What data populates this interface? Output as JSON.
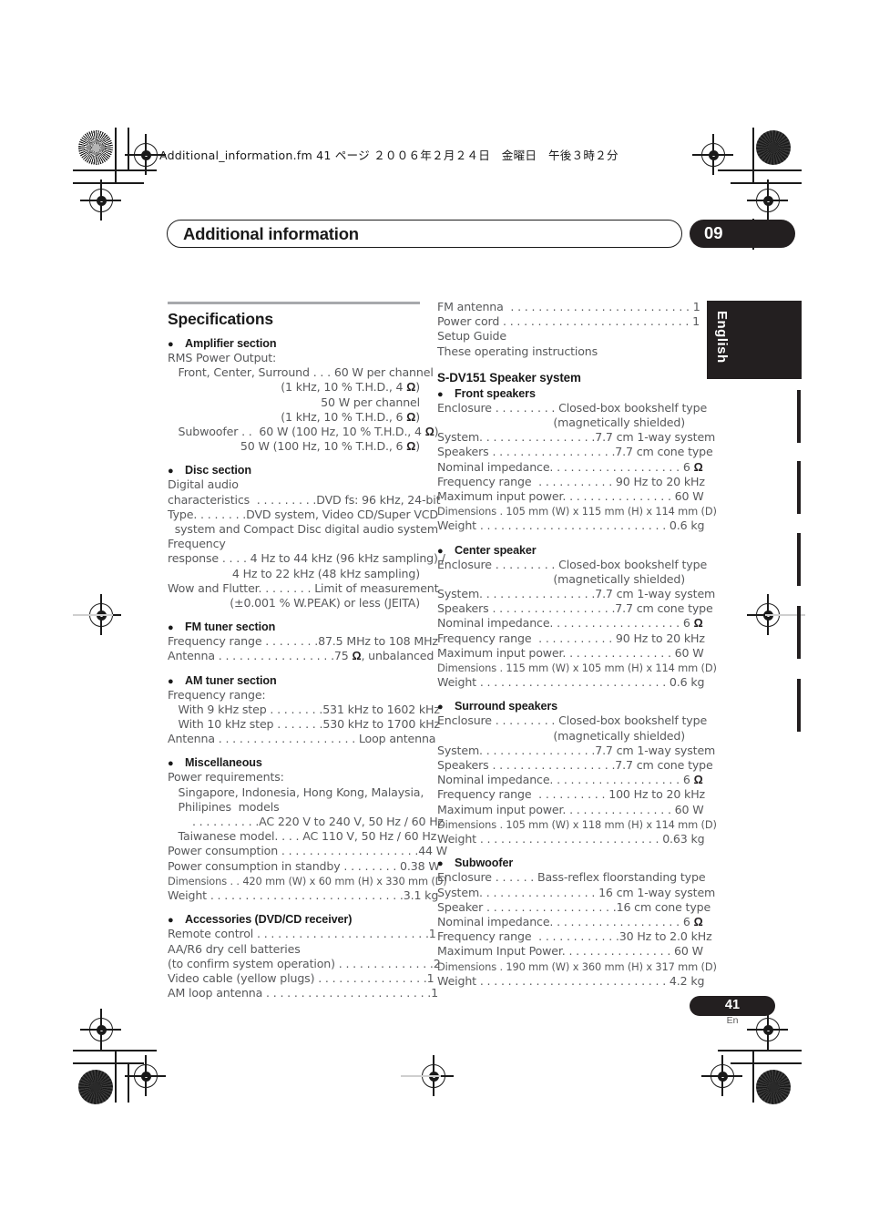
{
  "print_slug": "Additional_information.fm  41 ページ  ２００６年２月２４日　金曜日　午後３時２分",
  "chapter": {
    "title": "Additional information",
    "number": "09"
  },
  "side_tab_label": "English",
  "footer": {
    "page_number": "41",
    "language": "En"
  },
  "colors": {
    "ink": "#231f20",
    "body_text": "#58595b",
    "rule": "#a7a9ac"
  },
  "left_column": {
    "section_title": "Specifications",
    "groups": [
      {
        "heading": "Amplifier section",
        "lines": [
          {
            "text": "RMS Power Output:",
            "align": "left"
          },
          {
            "text": "   Front, Center, Surround . . . 60 W per channel",
            "align": "left"
          },
          {
            "text": "(1 kHz, 10 % T.H.D., 4 Ω)",
            "align": "right"
          },
          {
            "text": "50 W per channel",
            "align": "right"
          },
          {
            "text": "(1 kHz, 10 % T.H.D., 6 Ω)",
            "align": "right"
          },
          {
            "text": "   Subwoofer . .  60 W (100 Hz, 10 % T.H.D., 4 Ω)",
            "align": "left"
          },
          {
            "text": "50 W (100 Hz, 10 % T.H.D., 6 Ω)",
            "align": "right"
          }
        ]
      },
      {
        "heading": "Disc section",
        "lines": [
          {
            "text": "Digital audio",
            "align": "left"
          },
          {
            "text": "characteristics  . . . . . . . . .DVD fs: 96 kHz, 24-bit",
            "align": "left"
          },
          {
            "text": "Type. . . . . . . .DVD system, Video CD/Super VCD",
            "align": "left"
          },
          {
            "text": "  system and Compact Disc digital audio system",
            "align": "left"
          },
          {
            "text": "Frequency",
            "align": "left"
          },
          {
            "text": "response . . . . 4 Hz to 44 kHz (96 kHz sampling) /",
            "align": "left"
          },
          {
            "text": "4 Hz to 22 kHz (48 kHz sampling)",
            "align": "right"
          },
          {
            "text": "Wow and Flutter. . . . . . . . Limit of measurement",
            "align": "left"
          },
          {
            "text": "(±0.001 % W.PEAK) or less (JEITA)",
            "align": "right"
          }
        ]
      },
      {
        "heading": "FM tuner section",
        "lines": [
          {
            "text": "Frequency range . . . . . . . .87.5 MHz to 108 MHz",
            "align": "left"
          },
          {
            "text": "Antenna . . . . . . . . . . . . . . . . .75 Ω, unbalanced",
            "align": "left"
          }
        ]
      },
      {
        "heading": "AM tuner section",
        "lines": [
          {
            "text": "Frequency range:",
            "align": "left"
          },
          {
            "text": "   With 9 kHz step . . . . . . . .531 kHz to 1602 kHz",
            "align": "left"
          },
          {
            "text": "   With 10 kHz step . . . . . . .530 kHz to 1700 kHz",
            "align": "left"
          },
          {
            "text": "Antenna . . . . . . . . . . . . . . . . . . . . Loop antenna",
            "align": "left"
          }
        ]
      },
      {
        "heading": "Miscellaneous",
        "lines": [
          {
            "text": "Power requirements:",
            "align": "left"
          },
          {
            "text": "   Singapore, Indonesia, Hong Kong, Malaysia,",
            "align": "left"
          },
          {
            "text": "   Philipines  models",
            "align": "left"
          },
          {
            "text": "       . . . . . . . . . .AC 220 V to 240 V, 50 Hz / 60 Hz",
            "align": "left"
          },
          {
            "text": "   Taiwanese model. . . . AC 110 V, 50 Hz / 60 Hz",
            "align": "left"
          },
          {
            "text": "Power consumption . . . . . . . . . . . . . . . . . . . .44 W",
            "align": "left"
          },
          {
            "text": "Power consumption in standby . . . . . . . . 0.38 W",
            "align": "left"
          },
          {
            "text": "Dimensions . . 420 mm (W) x 60 mm (H) x 330 mm (D)",
            "align": "left",
            "small": true
          },
          {
            "text": "Weight . . . . . . . . . . . . . . . . . . . . . . . . . . . .3.1 kg",
            "align": "left"
          }
        ]
      },
      {
        "heading": "Accessories (DVD/CD receiver)",
        "lines": [
          {
            "text": "Remote control . . . . . . . . . . . . . . . . . . . . . . . . .1",
            "align": "left"
          },
          {
            "text": "AA/R6 dry cell batteries",
            "align": "left"
          },
          {
            "text": "(to confirm system operation) . . . . . . . . . . . . . .2",
            "align": "left"
          },
          {
            "text": "Video cable (yellow plugs) . . . . . . . . . . . . . . . .1",
            "align": "left"
          },
          {
            "text": "AM loop antenna . . . . . . . . . . . . . . . . . . . . . . . .1",
            "align": "left"
          }
        ]
      }
    ]
  },
  "right_column": {
    "continued_lines": [
      {
        "text": "FM antenna  . . . . . . . . . . . . . . . . . . . . . . . . . . 1",
        "align": "left"
      },
      {
        "text": "Power cord . . . . . . . . . . . . . . . . . . . . . . . . . . . 1",
        "align": "left"
      },
      {
        "text": "Setup Guide",
        "align": "left"
      },
      {
        "text": "These operating instructions",
        "align": "left"
      }
    ],
    "section_title": "S-DV151 Speaker system",
    "groups": [
      {
        "heading": "Front speakers",
        "lines": [
          {
            "text": "Enclosure . . . . . . . . . Closed-box bookshelf type",
            "align": "left"
          },
          {
            "text": "(magnetically shielded)",
            "align": "right"
          },
          {
            "text": "System. . . . . . . . . . . . . . . . .7.7 cm 1-way system",
            "align": "left"
          },
          {
            "text": "Speakers . . . . . . . . . . . . . . . . . .7.7 cm cone type",
            "align": "left"
          },
          {
            "text": "Nominal impedance. . . . . . . . . . . . . . . . . . . 6 Ω",
            "align": "left"
          },
          {
            "text": "Frequency range  . . . . . . . . . . . 90 Hz to 20 kHz",
            "align": "left"
          },
          {
            "text": "Maximum input power. . . . . . . . . . . . . . . . 60 W",
            "align": "left"
          },
          {
            "text": "Dimensions . 105 mm (W) x 115 mm (H) x 114 mm (D)",
            "align": "left",
            "small": true
          },
          {
            "text": "Weight . . . . . . . . . . . . . . . . . . . . . . . . . . . 0.6 kg",
            "align": "left"
          }
        ]
      },
      {
        "heading": "Center speaker",
        "lines": [
          {
            "text": "Enclosure . . . . . . . . . Closed-box bookshelf type",
            "align": "left"
          },
          {
            "text": "(magnetically shielded)",
            "align": "right"
          },
          {
            "text": "System. . . . . . . . . . . . . . . . .7.7 cm 1-way system",
            "align": "left"
          },
          {
            "text": "Speakers . . . . . . . . . . . . . . . . . .7.7 cm cone type",
            "align": "left"
          },
          {
            "text": "Nominal impedance. . . . . . . . . . . . . . . . . . . 6 Ω",
            "align": "left"
          },
          {
            "text": "Frequency range  . . . . . . . . . . . 90 Hz to 20 kHz",
            "align": "left"
          },
          {
            "text": "Maximum input power. . . . . . . . . . . . . . . . 60 W",
            "align": "left"
          },
          {
            "text": "Dimensions . 115 mm (W) x 105 mm (H) x 114 mm (D)",
            "align": "left",
            "small": true
          },
          {
            "text": "Weight . . . . . . . . . . . . . . . . . . . . . . . . . . . 0.6 kg",
            "align": "left"
          }
        ]
      },
      {
        "heading": "Surround speakers",
        "lines": [
          {
            "text": "Enclosure . . . . . . . . . Closed-box bookshelf type",
            "align": "left"
          },
          {
            "text": "(magnetically shielded)",
            "align": "right"
          },
          {
            "text": "System. . . . . . . . . . . . . . . . .7.7 cm 1-way system",
            "align": "left"
          },
          {
            "text": "Speakers . . . . . . . . . . . . . . . . . .7.7 cm cone type",
            "align": "left"
          },
          {
            "text": "Nominal impedance. . . . . . . . . . . . . . . . . . . 6 Ω",
            "align": "left"
          },
          {
            "text": "Frequency range  . . . . . . . . . . 100 Hz to 20 kHz",
            "align": "left"
          },
          {
            "text": "Maximum input power. . . . . . . . . . . . . . . . 60 W",
            "align": "left"
          },
          {
            "text": "Dimensions . 105 mm (W) x 118 mm (H) x 114 mm (D)",
            "align": "left",
            "small": true
          },
          {
            "text": "Weight . . . . . . . . . . . . . . . . . . . . . . . . . . 0.63 kg",
            "align": "left"
          }
        ]
      },
      {
        "heading": "Subwoofer",
        "lines": [
          {
            "text": "Enclosure . . . . . . Bass-reflex floorstanding type",
            "align": "left"
          },
          {
            "text": "System. . . . . . . . . . . . . . . . . 16 cm 1-way system",
            "align": "left"
          },
          {
            "text": "Speaker . . . . . . . . . . . . . . . . . . .16 cm cone type",
            "align": "left"
          },
          {
            "text": "Nominal impedance. . . . . . . . . . . . . . . . . . . 6 Ω",
            "align": "left"
          },
          {
            "text": "Frequency range  . . . . . . . . . . . .30 Hz to 2.0 kHz",
            "align": "left"
          },
          {
            "text": "Maximum Input Power. . . . . . . . . . . . . . . . 60 W",
            "align": "left"
          },
          {
            "text": "Dimensions . 190 mm (W) x 360 mm (H) x 317 mm (D)",
            "align": "left",
            "small": true
          },
          {
            "text": "Weight . . . . . . . . . . . . . . . . . . . . . . . . . . . 4.2 kg",
            "align": "left"
          }
        ]
      }
    ]
  }
}
